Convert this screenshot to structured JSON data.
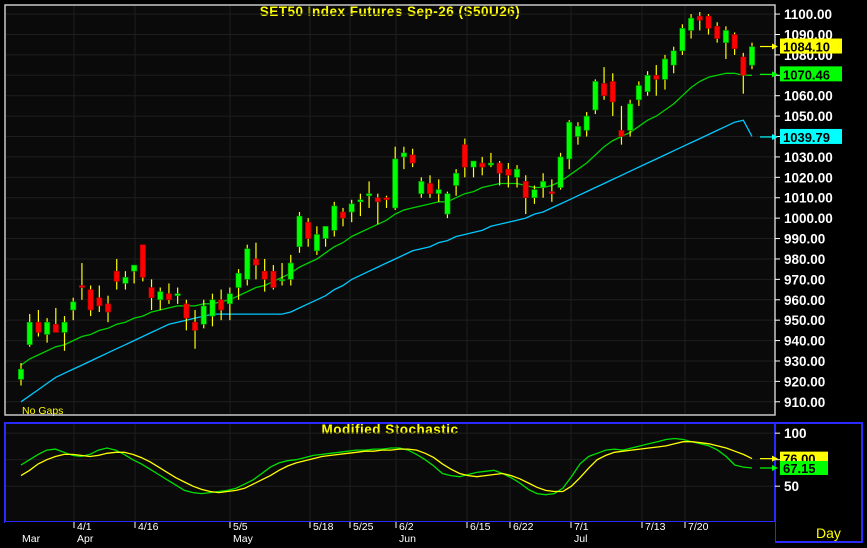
{
  "chart_data": [
    {
      "type": "candlestick",
      "title": "SET50  Index  Futures  Sep-26  (S50U26)",
      "note": "No  Gaps",
      "frequency_label": "Day",
      "ylim": [
        905,
        1102
      ],
      "y_ticks": [
        910,
        920,
        930,
        940,
        950,
        960,
        970,
        980,
        990,
        1000,
        1010,
        1020,
        1030,
        1040,
        1050,
        1060,
        1070,
        1080,
        1090,
        1100
      ],
      "y_tick_labels": [
        "910.00",
        "920.00",
        "930.00",
        "940.00",
        "950.00",
        "960.00",
        "970.00",
        "980.00",
        "990.00",
        "1000.00",
        "1010.00",
        "1020.00",
        "1030.00",
        "1040.00",
        "1050.00",
        "1060.00",
        "1070.00",
        "1080.00",
        "1090.00",
        "1100.00"
      ],
      "last_value_tags": [
        {
          "label": "1084.10",
          "series": "price",
          "color": "#ffff00"
        },
        {
          "label": "1070.46",
          "series": "ma_short",
          "color": "#00ff00"
        },
        {
          "label": "1039.79",
          "series": "ma_long",
          "color": "#00ffff"
        }
      ],
      "candles": [
        {
          "o": 921,
          "h": 929,
          "l": 918,
          "c": 926
        },
        {
          "o": 938,
          "h": 953,
          "l": 937,
          "c": 949
        },
        {
          "o": 949,
          "h": 955,
          "l": 942,
          "c": 944
        },
        {
          "o": 943,
          "h": 951,
          "l": 939,
          "c": 949
        },
        {
          "o": 948,
          "h": 956,
          "l": 944,
          "c": 944
        },
        {
          "o": 944,
          "h": 952,
          "l": 935,
          "c": 949
        },
        {
          "o": 955,
          "h": 961,
          "l": 950,
          "c": 959
        },
        {
          "o": 967,
          "h": 978,
          "l": 960,
          "c": 966
        },
        {
          "o": 965,
          "h": 967,
          "l": 952,
          "c": 955
        },
        {
          "o": 961,
          "h": 967,
          "l": 954,
          "c": 957
        },
        {
          "o": 958,
          "h": 962,
          "l": 949,
          "c": 954
        },
        {
          "o": 974,
          "h": 980,
          "l": 965,
          "c": 969
        },
        {
          "o": 968,
          "h": 974,
          "l": 965,
          "c": 971
        },
        {
          "o": 974,
          "h": 977,
          "l": 968,
          "c": 977
        },
        {
          "o": 987,
          "h": 987,
          "l": 969,
          "c": 971
        },
        {
          "o": 966,
          "h": 970,
          "l": 955,
          "c": 961
        },
        {
          "o": 960,
          "h": 966,
          "l": 955,
          "c": 964
        },
        {
          "o": 963,
          "h": 968,
          "l": 958,
          "c": 960
        },
        {
          "o": 962,
          "h": 966,
          "l": 958,
          "c": 963
        },
        {
          "o": 958,
          "h": 960,
          "l": 945,
          "c": 951
        },
        {
          "o": 949,
          "h": 955,
          "l": 936,
          "c": 945
        },
        {
          "o": 948,
          "h": 960,
          "l": 946,
          "c": 957
        },
        {
          "o": 952,
          "h": 963,
          "l": 947,
          "c": 960
        },
        {
          "o": 960,
          "h": 965,
          "l": 950,
          "c": 955
        },
        {
          "o": 958,
          "h": 966,
          "l": 950,
          "c": 963
        },
        {
          "o": 966,
          "h": 975,
          "l": 960,
          "c": 973
        },
        {
          "o": 970,
          "h": 987,
          "l": 967,
          "c": 985
        },
        {
          "o": 980,
          "h": 988,
          "l": 970,
          "c": 977
        },
        {
          "o": 974,
          "h": 980,
          "l": 964,
          "c": 970
        },
        {
          "o": 974,
          "h": 977,
          "l": 965,
          "c": 966
        },
        {
          "o": 970,
          "h": 978,
          "l": 967,
          "c": 970
        },
        {
          "o": 970,
          "h": 982,
          "l": 967,
          "c": 978
        },
        {
          "o": 986,
          "h": 1003,
          "l": 983,
          "c": 1001
        },
        {
          "o": 998,
          "h": 1000,
          "l": 986,
          "c": 990
        },
        {
          "o": 984,
          "h": 996,
          "l": 982,
          "c": 992
        },
        {
          "o": 990,
          "h": 996,
          "l": 986,
          "c": 996
        },
        {
          "o": 994,
          "h": 1008,
          "l": 991,
          "c": 1006
        },
        {
          "o": 1003,
          "h": 1005,
          "l": 996,
          "c": 1000
        },
        {
          "o": 1003,
          "h": 1009,
          "l": 998,
          "c": 1007
        },
        {
          "o": 1008,
          "h": 1012,
          "l": 1001,
          "c": 1009
        },
        {
          "o": 1011,
          "h": 1018,
          "l": 1005,
          "c": 1012
        },
        {
          "o": 1010,
          "h": 1012,
          "l": 997,
          "c": 1008
        },
        {
          "o": 1010,
          "h": 1011,
          "l": 1005,
          "c": 1009
        },
        {
          "o": 1005,
          "h": 1035,
          "l": 1004,
          "c": 1029
        },
        {
          "o": 1030,
          "h": 1035,
          "l": 1024,
          "c": 1032
        },
        {
          "o": 1031,
          "h": 1034,
          "l": 1025,
          "c": 1027
        },
        {
          "o": 1012,
          "h": 1020,
          "l": 1010,
          "c": 1018
        },
        {
          "o": 1017,
          "h": 1021,
          "l": 1010,
          "c": 1012
        },
        {
          "o": 1012,
          "h": 1019,
          "l": 1008,
          "c": 1014
        },
        {
          "o": 1002,
          "h": 1013,
          "l": 1000,
          "c": 1012
        },
        {
          "o": 1016,
          "h": 1024,
          "l": 1011,
          "c": 1022
        },
        {
          "o": 1036,
          "h": 1039,
          "l": 1020,
          "c": 1025
        },
        {
          "o": 1025,
          "h": 1028,
          "l": 1020,
          "c": 1028
        },
        {
          "o": 1027,
          "h": 1030,
          "l": 1021,
          "c": 1025
        },
        {
          "o": 1026,
          "h": 1032,
          "l": 1025,
          "c": 1027
        },
        {
          "o": 1027,
          "h": 1028,
          "l": 1016,
          "c": 1022
        },
        {
          "o": 1024,
          "h": 1027,
          "l": 1015,
          "c": 1021
        },
        {
          "o": 1020,
          "h": 1026,
          "l": 1015,
          "c": 1024
        },
        {
          "o": 1018,
          "h": 1021,
          "l": 1002,
          "c": 1010
        },
        {
          "o": 1010,
          "h": 1016,
          "l": 1007,
          "c": 1014
        },
        {
          "o": 1015,
          "h": 1022,
          "l": 1010,
          "c": 1018
        },
        {
          "o": 1013,
          "h": 1019,
          "l": 1008,
          "c": 1012
        },
        {
          "o": 1015,
          "h": 1032,
          "l": 1014,
          "c": 1030
        },
        {
          "o": 1029,
          "h": 1048,
          "l": 1024,
          "c": 1047
        },
        {
          "o": 1040,
          "h": 1047,
          "l": 1036,
          "c": 1045
        },
        {
          "o": 1043,
          "h": 1052,
          "l": 1040,
          "c": 1050
        },
        {
          "o": 1053,
          "h": 1068,
          "l": 1051,
          "c": 1067
        },
        {
          "o": 1066,
          "h": 1074,
          "l": 1058,
          "c": 1060
        },
        {
          "o": 1067,
          "h": 1071,
          "l": 1050,
          "c": 1057
        },
        {
          "o": 1043,
          "h": 1055,
          "l": 1036,
          "c": 1040
        },
        {
          "o": 1043,
          "h": 1058,
          "l": 1040,
          "c": 1056
        },
        {
          "o": 1058,
          "h": 1067,
          "l": 1055,
          "c": 1065
        },
        {
          "o": 1062,
          "h": 1072,
          "l": 1060,
          "c": 1070
        },
        {
          "o": 1070,
          "h": 1075,
          "l": 1060,
          "c": 1068
        },
        {
          "o": 1068,
          "h": 1080,
          "l": 1063,
          "c": 1078
        },
        {
          "o": 1075,
          "h": 1084,
          "l": 1071,
          "c": 1082
        },
        {
          "o": 1082,
          "h": 1095,
          "l": 1080,
          "c": 1093
        },
        {
          "o": 1092,
          "h": 1100,
          "l": 1088,
          "c": 1098
        },
        {
          "o": 1099,
          "h": 1101,
          "l": 1092,
          "c": 1097
        },
        {
          "o": 1099,
          "h": 1100,
          "l": 1090,
          "c": 1093
        },
        {
          "o": 1094,
          "h": 1096,
          "l": 1086,
          "c": 1088
        },
        {
          "o": 1086,
          "h": 1094,
          "l": 1078,
          "c": 1092
        },
        {
          "o": 1090,
          "h": 1091,
          "l": 1080,
          "c": 1083
        },
        {
          "o": 1079,
          "h": 1081,
          "l": 1061,
          "c": 1070
        },
        {
          "o": 1075,
          "h": 1086,
          "l": 1073,
          "c": 1084
        }
      ],
      "ma_short": [
        928,
        931,
        933,
        935,
        937,
        938,
        940,
        942,
        943,
        945,
        946,
        948,
        949,
        951,
        952,
        954,
        955,
        956,
        957,
        957,
        957,
        958,
        958,
        959,
        960,
        962,
        964,
        966,
        967,
        969,
        971,
        973,
        976,
        978,
        980,
        983,
        986,
        988,
        991,
        993,
        995,
        997,
        999,
        1002,
        1004,
        1005,
        1006,
        1007,
        1008,
        1008,
        1010,
        1012,
        1013,
        1015,
        1016,
        1017,
        1017,
        1017,
        1016,
        1015,
        1015,
        1016,
        1018,
        1021,
        1024,
        1027,
        1031,
        1035,
        1038,
        1040,
        1042,
        1045,
        1048,
        1050,
        1053,
        1056,
        1060,
        1064,
        1067,
        1069,
        1070,
        1071,
        1071,
        1070,
        1070
      ],
      "ma_long": [
        910,
        913,
        916,
        919,
        922,
        924,
        926,
        928,
        930,
        932,
        934,
        936,
        938,
        940,
        942,
        944,
        946,
        948,
        949,
        950,
        951,
        952,
        953,
        953,
        953,
        953,
        953,
        953,
        953,
        953,
        953,
        954,
        956,
        958,
        960,
        962,
        965,
        967,
        970,
        972,
        974,
        976,
        978,
        980,
        982,
        984,
        985,
        986,
        988,
        989,
        991,
        992,
        993,
        994,
        996,
        997,
        998,
        999,
        1000,
        1002,
        1003,
        1005,
        1007,
        1009,
        1011,
        1013,
        1015,
        1017,
        1019,
        1021,
        1023,
        1025,
        1027,
        1029,
        1031,
        1033,
        1035,
        1037,
        1039,
        1041,
        1043,
        1045,
        1047,
        1048,
        1040
      ]
    },
    {
      "type": "line",
      "title": "Modified  Stochastic",
      "ylim": [
        20,
        103
      ],
      "y_ticks": [
        50,
        75,
        100
      ],
      "y_tick_labels": [
        "50",
        "75",
        "100"
      ],
      "last_value_tags": [
        {
          "label": "76.00",
          "series": "slow",
          "color": "#ffff00"
        },
        {
          "label": "67.15",
          "series": "fast",
          "color": "#00ff00"
        }
      ],
      "series": [
        {
          "key": "fast",
          "values": [
            70,
            75,
            80,
            84,
            85,
            82,
            79,
            78,
            80,
            84,
            86,
            84,
            80,
            75,
            71,
            66,
            61,
            56,
            51,
            46,
            44,
            43,
            44,
            45,
            46,
            48,
            52,
            56,
            62,
            68,
            72,
            74,
            75,
            77,
            79,
            80,
            81,
            82,
            83,
            84,
            84,
            85,
            85,
            86,
            86,
            84,
            80,
            75,
            69,
            62,
            60,
            59,
            61,
            63,
            64,
            65,
            62,
            58,
            53,
            47,
            43,
            42,
            43,
            48,
            59,
            71,
            78,
            81,
            84,
            85,
            84,
            86,
            88,
            90,
            92,
            94,
            95,
            94,
            92,
            90,
            88,
            84,
            78,
            70,
            68,
            67.15
          ]
        },
        {
          "key": "slow",
          "values": [
            60,
            65,
            71,
            75,
            78,
            80,
            80,
            79,
            78,
            79,
            81,
            82,
            82,
            80,
            77,
            73,
            68,
            63,
            58,
            54,
            50,
            47,
            45,
            44,
            45,
            46,
            48,
            52,
            56,
            60,
            65,
            69,
            72,
            74,
            76,
            78,
            79,
            80,
            81,
            82,
            83,
            83,
            84,
            84,
            85,
            85,
            84,
            81,
            77,
            71,
            66,
            62,
            60,
            59,
            60,
            61,
            62,
            60,
            57,
            53,
            49,
            46,
            45,
            45,
            50,
            58,
            67,
            75,
            79,
            82,
            83,
            84,
            85,
            86,
            87,
            88,
            90,
            92,
            92,
            91,
            90,
            88,
            86,
            83,
            80,
            76
          ]
        }
      ],
      "date_labels": [
        "Mar",
        "4/1",
        "Apr",
        "4/16",
        "5/5",
        "May",
        "5/18",
        "5/25",
        "6/2",
        "Jun",
        "6/15",
        "6/22",
        "7/1",
        "Jul",
        "7/13",
        "7/20"
      ]
    }
  ],
  "colors": {
    "up": "#00ff00",
    "down": "#ff0000",
    "wick": "#ffff00",
    "ma_short": "#00d000",
    "ma_long": "#00c8ff",
    "frame_upper": "#c0c0c0",
    "frame_lower": "#2222ff",
    "title": "#ffff00"
  }
}
